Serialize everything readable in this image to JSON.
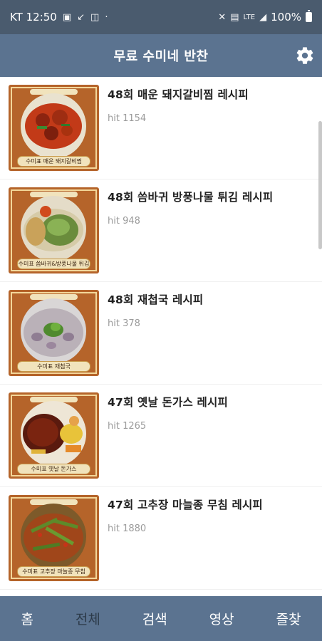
{
  "status_bar": {
    "carrier_time": "KT 12:50",
    "network": "LTE",
    "battery": "100%"
  },
  "app_bar": {
    "title": "무료 수미네 반찬",
    "settings_icon": "gear-icon"
  },
  "colors": {
    "status_bar": "#4a5b6e",
    "app_bar": "#5b7390",
    "bottom_nav": "#5b7390"
  },
  "items": [
    {
      "title": "48회 매운 돼지갈비찜 레시피",
      "hit": "hit 1154",
      "thumb_caption": "수미표 매운 돼지갈비찜"
    },
    {
      "title": "48회 씀바귀 방풍나물 튀김 레시피",
      "hit": "hit 948",
      "thumb_caption": "수미표 씀바귀&방풍나물 튀김"
    },
    {
      "title": "48회 재첩국 레시피",
      "hit": "hit 378",
      "thumb_caption": "수미표 재첩국"
    },
    {
      "title": "47회 옛날 돈가스 레시피",
      "hit": "hit 1265",
      "thumb_caption": "수미표 옛날 돈가스"
    },
    {
      "title": "47회 고추장 마늘종 무침 레시피",
      "hit": "hit 1880",
      "thumb_caption": "수미표 고추장 마늘종 무침"
    }
  ],
  "bottom_nav": {
    "items": [
      "홈",
      "전체",
      "검색",
      "영상",
      "즐찾"
    ],
    "active": "전체"
  }
}
